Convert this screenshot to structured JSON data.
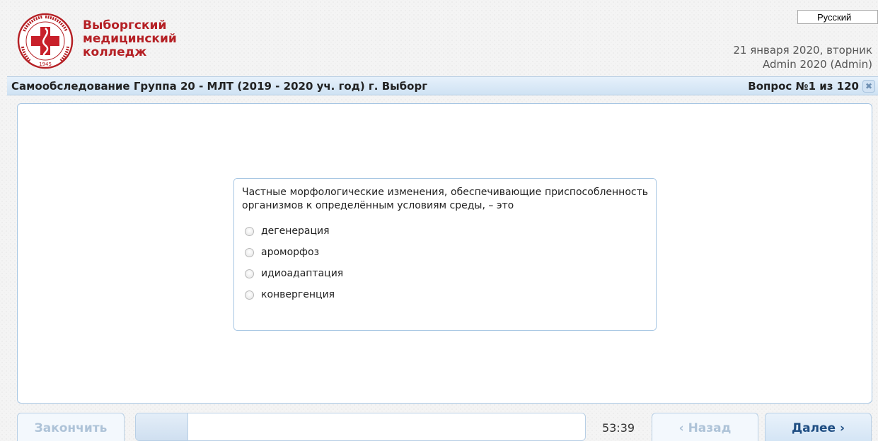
{
  "header": {
    "logo_year": "1945",
    "college_name": [
      "Выборгский",
      "медицинский",
      "колледж"
    ],
    "language": "Русский",
    "date": "21 января 2020, вторник",
    "user": "Admin 2020 (Admin)"
  },
  "test": {
    "title": "Самообследование Группа 20 - МЛТ (2019 - 2020 уч. год) г. Выборг",
    "counter": "Вопрос №1 из 120",
    "close_symbol": "✖"
  },
  "question": {
    "text": "Частные морфологические изменения, обеспечивающие приспособленность организмов к определённым условиям среды, – это",
    "options": [
      "дегенерация",
      "ароморфоз",
      "идиоадаптация",
      "конвергенция"
    ]
  },
  "footer": {
    "finish_label": "Закончить",
    "timer": "53:39",
    "back_label": "‹ Назад",
    "next_label": "Далее ›",
    "progress_fraction": 0.115
  },
  "colors": {
    "brand_red": "#b52025",
    "panel_border": "#a7c6e3",
    "title_bar": "#d9e8f6",
    "next_text": "#1f4e83"
  }
}
